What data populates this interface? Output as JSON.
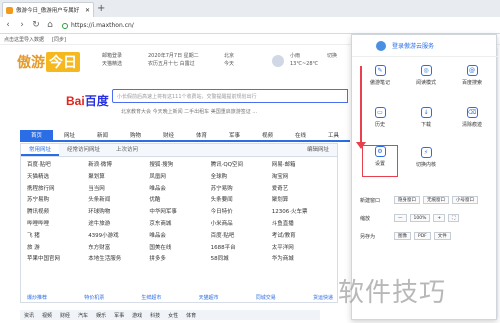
{
  "tab": {
    "title": "傲游今日_傲游用户专属好"
  },
  "address": {
    "url": "https://i.maxthon.cn/"
  },
  "bookmarks": [
    "点击这里导入数据",
    "[同步]"
  ],
  "header": {
    "logo_a": "傲游",
    "logo_b": "今日",
    "info1": [
      "邮箱登录",
      "天猫精选"
    ],
    "info2": [
      "2020年7月7日 星期二",
      "农历五月十七 白露过"
    ],
    "info3": [
      "北京",
      "今天"
    ],
    "weather": [
      "小雨",
      "13℃~28℃"
    ],
    "city": [
      "切换"
    ]
  },
  "baidu": {
    "logo_a": "Bai",
    "logo_b": "百度",
    "placeholder": "小长假前后高速上将有这111个收费站，交警提醒提前规划出行"
  },
  "hotlinks": "北京教育大会 今天晚上新闻 二手出租车 美国重启旅游签证 ...",
  "nav": [
    "首页",
    "网址",
    "新闻",
    "购物",
    "财经",
    "体育",
    "军事",
    "视频",
    "在线",
    "工具"
  ],
  "panel_tabs": [
    "常用网址",
    "经常访问网址",
    "上次访问"
  ],
  "panel_action": "编辑网址",
  "grid": [
    "百度·贴吧",
    "新浪·微博",
    "搜狐·搜狗",
    "腾讯·QQ空间",
    "网易·邮箱",
    "天猫精选",
    "聚划算",
    "凤凰网",
    "全球购",
    "淘宝网",
    "携程旅行网",
    "当当网",
    "唯品会",
    "苏宁易购",
    "爱奇艺",
    "苏宁易购",
    "头条新闻",
    "优酷",
    "头条要闻",
    "聚划算",
    "腾讯视频",
    "环球购物",
    "中华网军事",
    "今日特价",
    "12306·火车票",
    "哔哩哔哩",
    "途牛旅游",
    "京东商城",
    "小米商品",
    "斗鱼直播",
    "飞 猪",
    "4399小游戏",
    "唯品会",
    "百度·贴吧",
    "考试/教育",
    "旅 游",
    "东方财富",
    "国美在线",
    "1688平台",
    "太平洋网",
    "苹果中国官网",
    "本地生活服务",
    "拼多多",
    "58同城",
    "华为商城"
  ],
  "bottom_links": [
    "爆炒推荐",
    "特价机票",
    "生鲜超市",
    "天猫超市",
    "同城交易",
    "货运快递"
  ],
  "catbar": [
    "资讯",
    "视频",
    "财经",
    "汽车",
    "娱乐",
    "军事",
    "游戏",
    "科技",
    "女性",
    "体育"
  ],
  "menu": {
    "login": "登录傲游云服务",
    "items": [
      "傲游笔记",
      "阅读模式",
      "百度搜索",
      "历史",
      "下载",
      "清除痕迹",
      "设置",
      "切换内核"
    ],
    "rows": [
      {
        "label": "新建窗口",
        "buttons": [
          "隐身窗口",
          "无痕窗口",
          "小号窗口"
        ]
      },
      {
        "label": "缩放",
        "buttons": [
          "—",
          "100%",
          "+",
          "⛶"
        ]
      },
      {
        "label": "另存为",
        "buttons": [
          "图像",
          "PDF",
          "文件"
        ]
      }
    ]
  },
  "watermark": "软件技巧",
  "colors": {
    "accent": "#2b6de5",
    "highlight": "#e8414d"
  }
}
